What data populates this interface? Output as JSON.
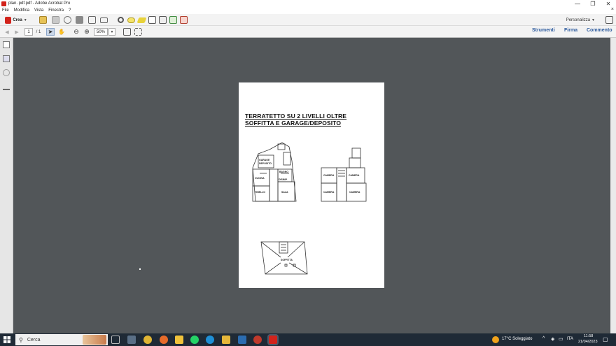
{
  "window": {
    "title": "plan. pdf.pdf - Adobe Acrobat Pro",
    "controls": {
      "minimize": "—",
      "restore": "❐",
      "close": "✕"
    }
  },
  "menu": {
    "items": [
      "File",
      "Modifica",
      "Vista",
      "Finestra",
      "?"
    ],
    "close_doc": "×"
  },
  "toolbar": {
    "create_label": "Crea",
    "customize_label": "Personalizza",
    "page_current": "1",
    "page_total": "/ 1",
    "zoom": "50%"
  },
  "right_panel_links": {
    "tools": "Strumenti",
    "sign": "Firma",
    "comment": "Commento"
  },
  "document": {
    "title_line1": "TERRATETTO SU 2 LIVELLI OLTRE",
    "title_line2": "SOFFITTA E GARAGE/DEPOSITO",
    "plan1_labels": [
      "GARAGE DEPOSITO",
      "CUCINA",
      "BAGNO",
      "DISIMP.",
      "TINELLO",
      "SALA"
    ],
    "plan2_labels": [
      "CAMERA",
      "CAMERA",
      "CAMERA",
      "CAMERA"
    ],
    "plan3_label": "SOFFITTA"
  },
  "taskbar": {
    "search_placeholder": "Cerca",
    "weather": "17°C  Soleggiato",
    "language": "ITA",
    "time": "11:58",
    "date": "21/04/2023"
  },
  "colors": {
    "acrobat_red": "#d2231b",
    "link_blue": "#2d5b9e",
    "doc_bg": "#525659",
    "taskbar": "#1f2a36"
  }
}
